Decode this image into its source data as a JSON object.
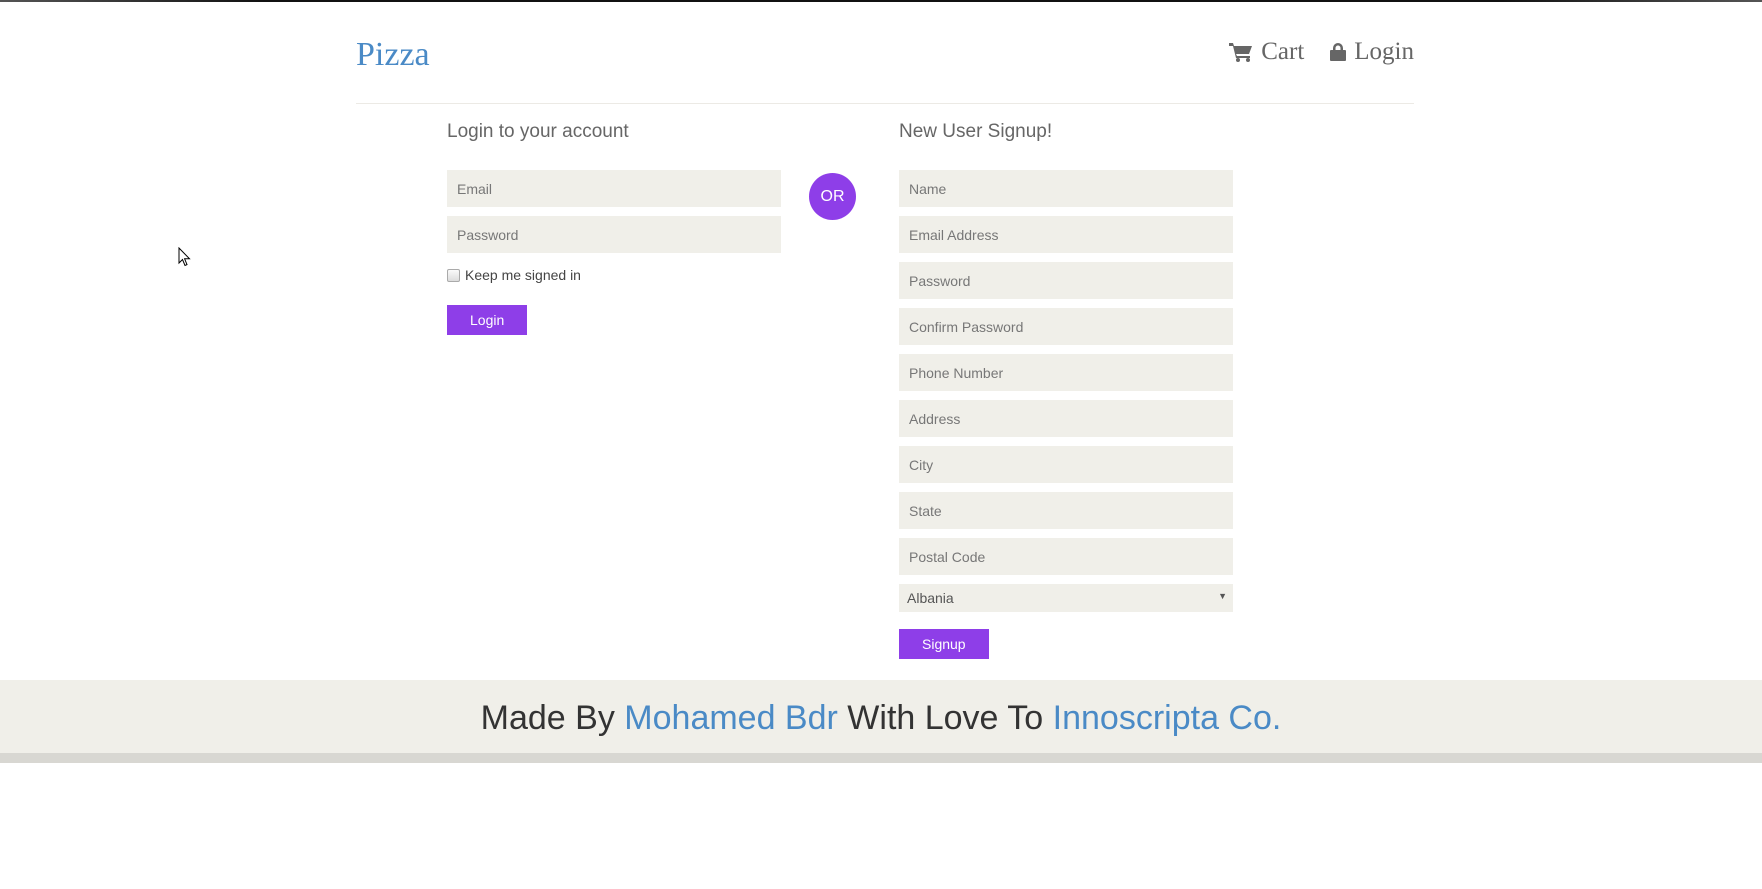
{
  "header": {
    "brand": "Pizza",
    "nav": {
      "cart": "Cart",
      "login": "Login"
    }
  },
  "login": {
    "title": "Login to your account",
    "email_placeholder": "Email",
    "password_placeholder": "Password",
    "keep_signed_in": "Keep me signed in",
    "submit": "Login"
  },
  "divider": {
    "or": "OR"
  },
  "signup": {
    "title": "New User Signup!",
    "name_placeholder": "Name",
    "email_placeholder": "Email Address",
    "password_placeholder": "Password",
    "confirm_placeholder": "Confirm Password",
    "phone_placeholder": "Phone Number",
    "address_placeholder": "Address",
    "city_placeholder": "City",
    "state_placeholder": "State",
    "postal_placeholder": "Postal Code",
    "country_selected": "Albania",
    "submit": "Signup"
  },
  "footer": {
    "prefix": "Made By",
    "author": "Mohamed Bdr",
    "middle": "With Love To",
    "company": "Innoscripta Co."
  },
  "colors": {
    "brand": "#4a8ac6",
    "accent": "#8e3ee8",
    "field_bg": "#f0efe9"
  },
  "icons": {
    "cart": "shopping-cart-icon",
    "login": "lock-icon",
    "select": "chevron-down-icon"
  }
}
